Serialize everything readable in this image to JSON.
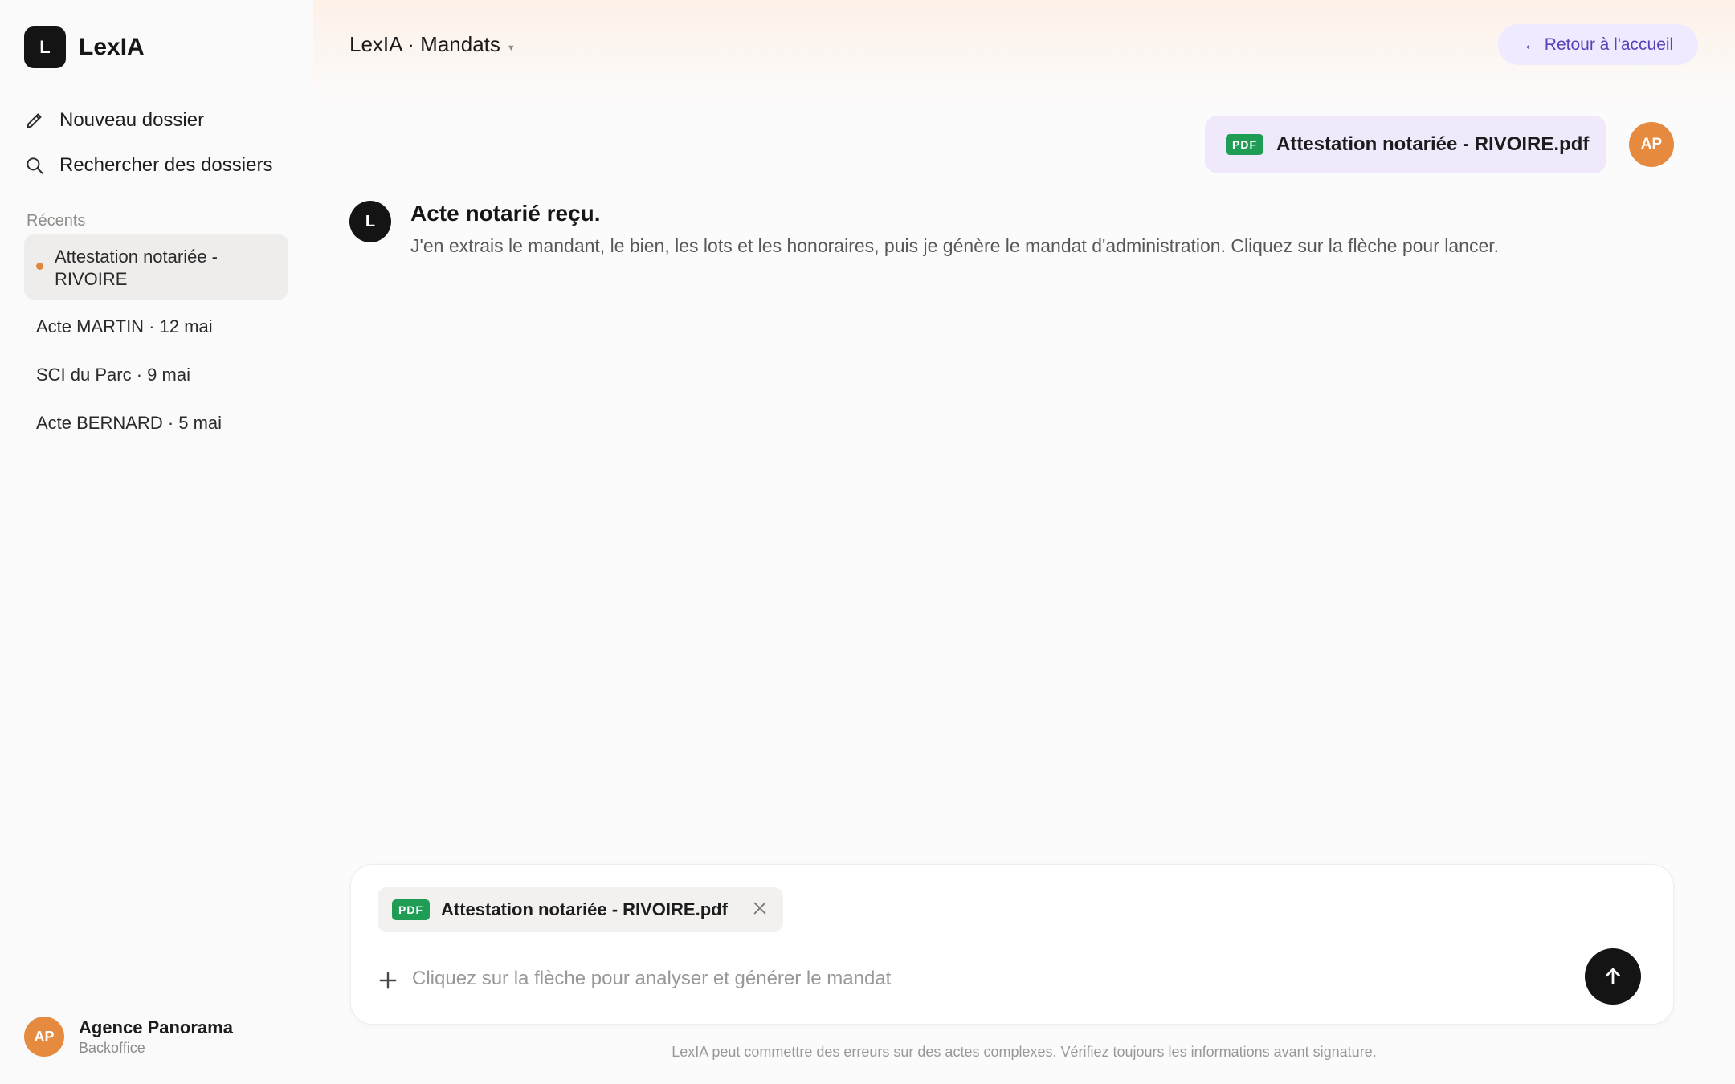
{
  "brand": {
    "logo_letter": "L",
    "name": "LexIA"
  },
  "sidebar": {
    "new_folder": "Nouveau dossier",
    "search_folders": "Rechercher des dossiers",
    "recents_heading": "Récents",
    "recents": [
      {
        "label": "Attestation notariée - RIVOIRE",
        "active": true
      },
      {
        "label": "Acte MARTIN · 12 mai"
      },
      {
        "label": "SCI du Parc · 9 mai"
      },
      {
        "label": "Acte BERNARD · 5 mai"
      }
    ]
  },
  "account": {
    "initials": "AP",
    "name": "Agence Panorama",
    "role": "Backoffice",
    "color": "#e68a3f"
  },
  "header": {
    "breadcrumb": "LexIA · Mandats",
    "back_label": "Retour à l'accueil"
  },
  "conversation": {
    "user_file": {
      "badge": "PDF",
      "name": "Attestation notariée - RIVOIRE.pdf"
    },
    "user_initials": "AP",
    "bot_initial": "L",
    "bot_title": "Acte notarié reçu.",
    "bot_text": "J'en extrais le mandant, le bien, les lots et les honoraires, puis je génère le mandat d'administration. Cliquez sur la flèche pour lancer."
  },
  "composer": {
    "attachment": {
      "badge": "PDF",
      "name": "Attestation notariée - RIVOIRE.pdf"
    },
    "placeholder": "Cliquez sur la flèche pour analyser et générer le mandat",
    "value": ""
  },
  "disclaimer": "LexIA peut commettre des erreurs sur des actes complexes. Vérifiez toujours les informations avant signature.",
  "colors": {
    "accent_purple": "#5a42b8",
    "pdf_green": "#1f9d55",
    "avatar_orange": "#e68a3f"
  }
}
